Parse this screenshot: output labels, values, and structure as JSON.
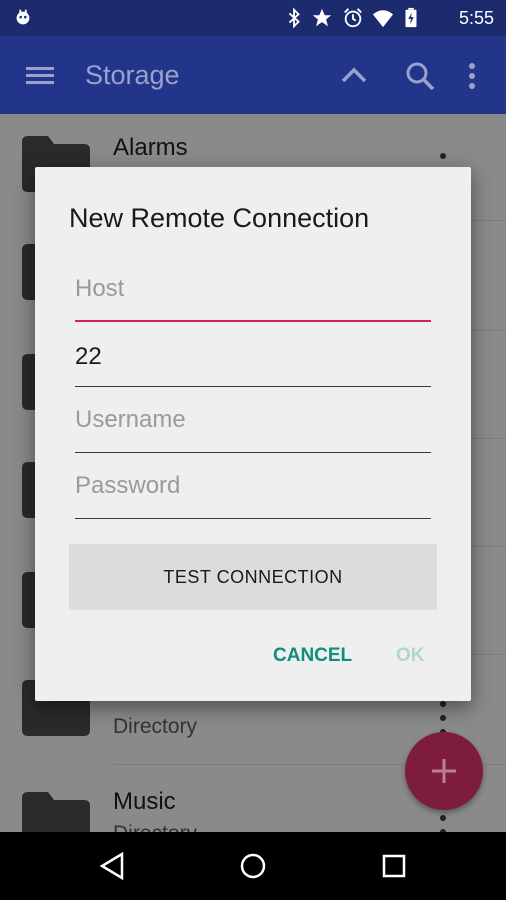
{
  "status_bar": {
    "time": "5:55",
    "icons": [
      "android-icon",
      "bluetooth-icon",
      "star-icon",
      "alarm-icon",
      "wifi-icon",
      "battery-icon"
    ]
  },
  "app_bar": {
    "title": "Storage"
  },
  "list": {
    "items": [
      {
        "name": "Alarms",
        "sub": ""
      },
      {
        "name": "",
        "sub": ""
      },
      {
        "name": "",
        "sub": ""
      },
      {
        "name": "",
        "sub": ""
      },
      {
        "name": "",
        "sub": ""
      },
      {
        "name": "",
        "sub": "Directory"
      },
      {
        "name": "Music",
        "sub": "Directory"
      }
    ]
  },
  "dialog": {
    "title": "New Remote Connection",
    "host": {
      "value": "",
      "placeholder": "Host"
    },
    "port": {
      "value": "22",
      "placeholder": ""
    },
    "username": {
      "value": "",
      "placeholder": "Username"
    },
    "password": {
      "value": "",
      "placeholder": "Password"
    },
    "test_button": "TEST CONNECTION",
    "cancel_label": "CANCEL",
    "ok_label": "OK"
  },
  "colors": {
    "accent": "#d3245a",
    "primary": "#23358a",
    "dialog_action": "#0f8f7f",
    "ok_disabled": "#b0d6d2"
  }
}
